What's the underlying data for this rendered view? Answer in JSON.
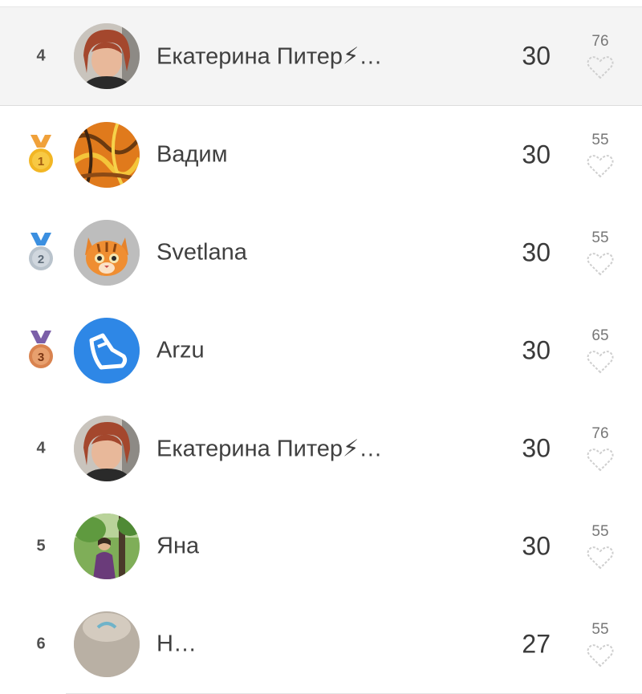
{
  "rows": [
    {
      "rank": "4",
      "medal": "",
      "avatar_icon": "woman-photo-avatar",
      "name": "Екатерина Питер⚡…",
      "score": "30",
      "likes": "76",
      "highlight": true
    },
    {
      "rank": "1",
      "medal": "gold-medal-icon",
      "avatar_icon": "abstract-painting-avatar",
      "name": "Вадим",
      "score": "30",
      "likes": "55"
    },
    {
      "rank": "2",
      "medal": "silver-medal-icon",
      "avatar_icon": "cat-face-avatar",
      "name": "Svetlana",
      "score": "30",
      "likes": "55"
    },
    {
      "rank": "3",
      "medal": "bronze-medal-icon",
      "avatar_icon": "sneaker-avatar",
      "name": "Arzu",
      "score": "30",
      "likes": "65"
    },
    {
      "rank": "4",
      "medal": "",
      "avatar_icon": "woman-photo-avatar",
      "name": "Екатерина Питер⚡…",
      "score": "30",
      "likes": "76"
    },
    {
      "rank": "5",
      "medal": "",
      "avatar_icon": "park-photo-avatar",
      "name": "Яна",
      "score": "30",
      "likes": "55"
    },
    {
      "rank": "6",
      "medal": "",
      "avatar_icon": "stone-photo-avatar",
      "name": "Н…",
      "score": "27",
      "likes": "55"
    }
  ],
  "colors": {
    "gold": "#f2b624",
    "silver": "#b9c3cc",
    "bronze": "#d9834f",
    "ribbon_blue": "#3b8fe0",
    "ribbon_purple": "#7b5fa8",
    "avatar_blue": "#2e87e6"
  }
}
